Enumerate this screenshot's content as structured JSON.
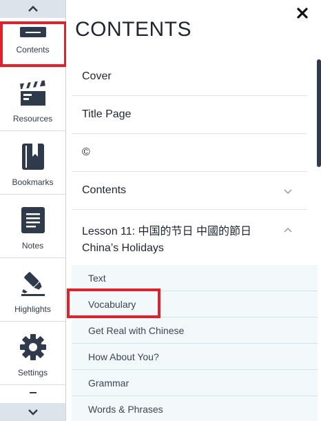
{
  "rail": {
    "items": [
      {
        "label": "Contents",
        "icon": "contents-icon"
      },
      {
        "label": "Resources",
        "icon": "clapperboard-icon"
      },
      {
        "label": "Bookmarks",
        "icon": "bookmark-icon"
      },
      {
        "label": "Notes",
        "icon": "notes-icon"
      },
      {
        "label": "Highlights",
        "icon": "highlighter-icon"
      },
      {
        "label": "Settings",
        "icon": "gear-icon"
      }
    ]
  },
  "panel": {
    "title": "CONTENTS",
    "items": [
      {
        "label": "Cover"
      },
      {
        "label": "Title Page"
      },
      {
        "label": "©"
      },
      {
        "label": "Contents",
        "expanded": false
      },
      {
        "label_line1": "Lesson 11: 中国的节日 中國的節日",
        "label_line2": "China’s Holidays",
        "expanded": true
      }
    ],
    "subitems": [
      {
        "label": "Text"
      },
      {
        "label": "Vocabulary"
      },
      {
        "label": "Get Real with Chinese"
      },
      {
        "label": "How About You?"
      },
      {
        "label": "Grammar"
      },
      {
        "label": "Words & Phrases"
      }
    ]
  },
  "colors": {
    "accent_dark": "#2f3a4b",
    "highlight_red": "#e0202a",
    "sub_bg": "#f3f8fb"
  }
}
